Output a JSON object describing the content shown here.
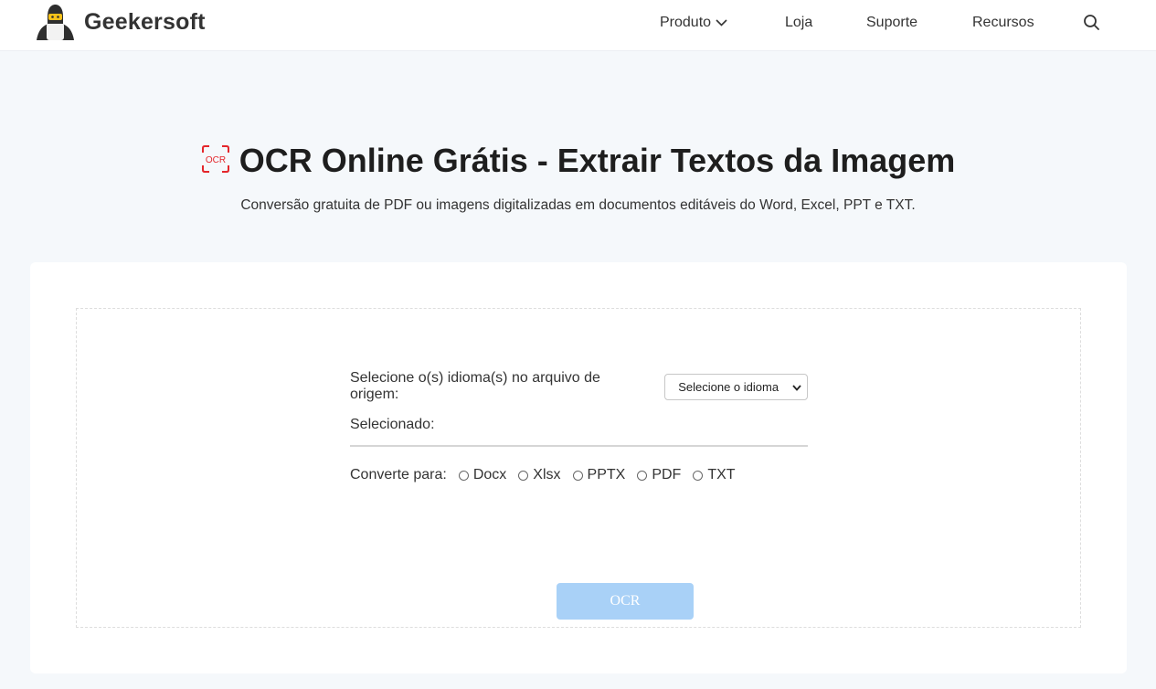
{
  "header": {
    "logo_text": "Geekersoft",
    "nav": {
      "produto": "Produto",
      "loja": "Loja",
      "suporte": "Suporte",
      "recursos": "Recursos"
    }
  },
  "hero": {
    "icon_label": "OCR",
    "title": "OCR Online Grátis - Extrair Textos da Imagem",
    "subtitle": "Conversão gratuita de PDF ou imagens digitalizadas em documentos editáveis do Word, Excel, PPT e TXT."
  },
  "form": {
    "language_label": "Selecione o(s) idioma(s) no arquivo de origem:",
    "language_select_value": "Selecione o idioma",
    "selected_label": "Selecionado:",
    "convert_label": "Converte para:",
    "formats": [
      "Docx",
      "Xlsx",
      "PPTX",
      "PDF",
      "TXT"
    ],
    "ocr_button": "OCR"
  },
  "colors": {
    "accent_red": "#e4262b",
    "button_disabled": "#a9d1f7",
    "page_background": "#f5f8fb"
  },
  "icons": [
    "penguin-logo-icon",
    "chevron-down-icon",
    "search-icon",
    "ocr-scan-icon",
    "select-chevron-icon"
  ]
}
